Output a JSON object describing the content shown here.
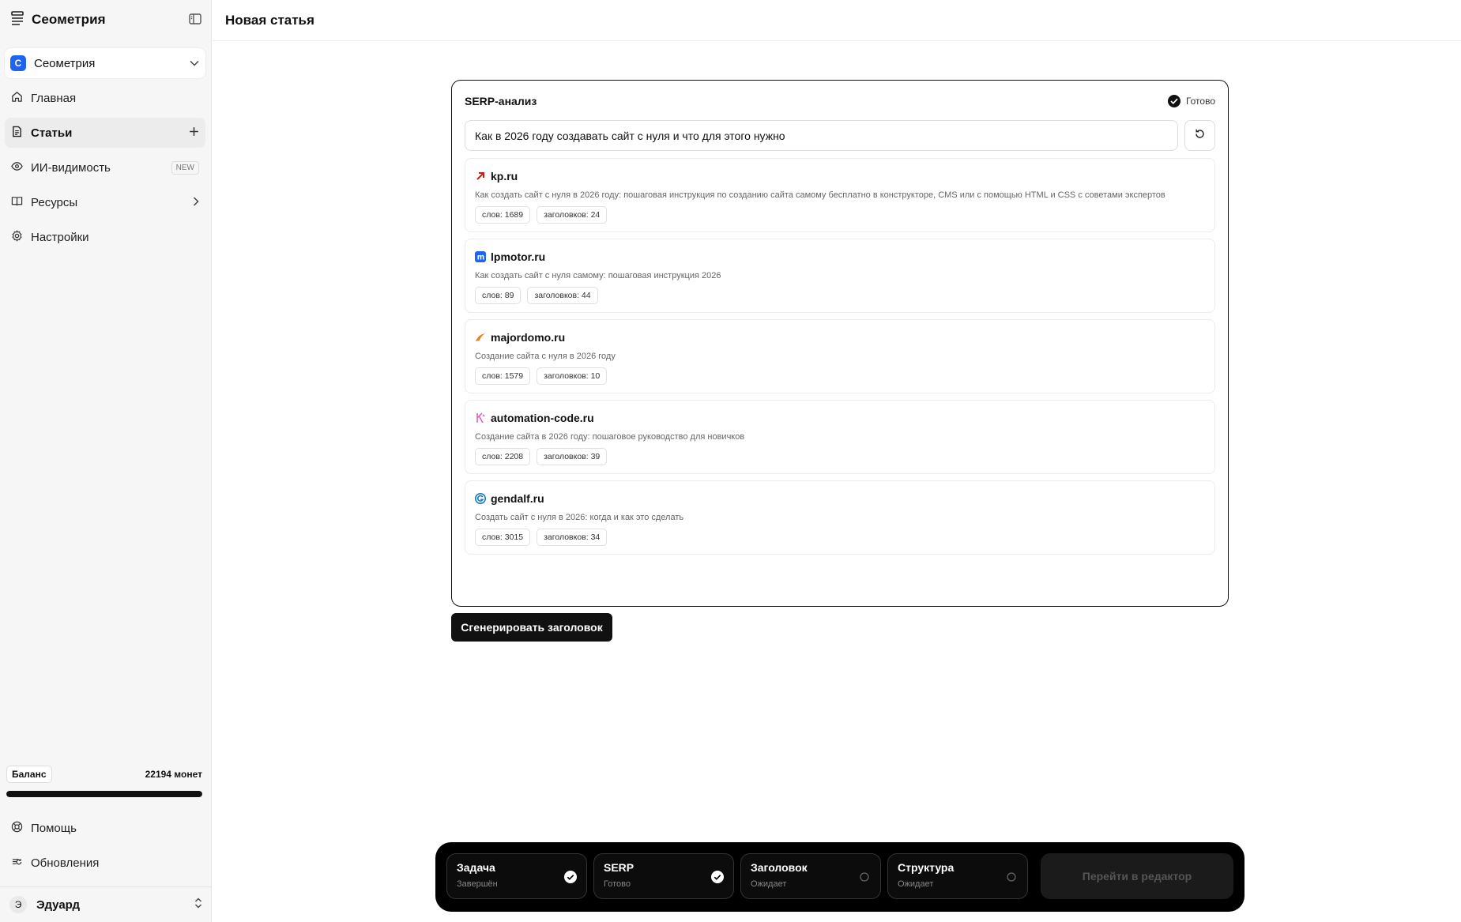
{
  "app": {
    "name": "Сеометрия"
  },
  "workspace": {
    "badge": "С",
    "name": "Сеометрия"
  },
  "sidebar": {
    "items": [
      {
        "label": "Главная",
        "icon": "home-icon"
      },
      {
        "label": "Статьи",
        "icon": "document-icon",
        "active": true
      },
      {
        "label": "ИИ-видимость",
        "icon": "eye-icon",
        "badge": "NEW"
      },
      {
        "label": "Ресурсы",
        "icon": "book-icon"
      },
      {
        "label": "Настройки",
        "icon": "gear-icon"
      }
    ],
    "bottom_items": [
      {
        "label": "Помощь",
        "icon": "lifebuoy-icon"
      },
      {
        "label": "Обновления",
        "icon": "refresh-list-icon"
      }
    ]
  },
  "balance": {
    "label": "Баланс",
    "value": "22194 монет",
    "fill_fraction": 1.0
  },
  "user": {
    "initial": "Э",
    "name": "Эдуард"
  },
  "header": {
    "title": "Новая статья"
  },
  "serp": {
    "title": "SERP-анализ",
    "status": "Готово",
    "query": "Как в 2026 году создавать сайт с нуля и что для этого нужно",
    "results": [
      {
        "domain": "kp.ru",
        "snippet": "Как создать сайт с нуля в 2026 году: пошаговая инструкция по созданию сайта самому бесплатно в конструкторе, CMS или с помощью HTML и CSS с советами экспертов",
        "words": "слов: 1689",
        "headings": "заголовков: 24"
      },
      {
        "domain": "lpmotor.ru",
        "snippet": "Как создать сайт с нуля самому: пошаговая инструкция 2026",
        "words": "слов: 89",
        "headings": "заголовков: 44"
      },
      {
        "domain": "majordomo.ru",
        "snippet": "Создание сайта с нуля в 2026 году",
        "words": "слов: 1579",
        "headings": "заголовков: 10"
      },
      {
        "domain": "automation-code.ru",
        "snippet": "Создание сайта в 2026 году: пошаговое руководство для новичков",
        "words": "слов: 2208",
        "headings": "заголовков: 39"
      },
      {
        "domain": "gendalf.ru",
        "snippet": "Создать сайт с нуля в 2026: когда и как это сделать",
        "words": "слов: 3015",
        "headings": "заголовков: 34"
      }
    ]
  },
  "actions": {
    "generate_title": "Сгенерировать заголовок"
  },
  "stepper": {
    "steps": [
      {
        "title": "Задача",
        "status": "Завершён",
        "done": true
      },
      {
        "title": "SERP",
        "status": "Готово",
        "done": true
      },
      {
        "title": "Заголовок",
        "status": "Ожидает",
        "done": false
      },
      {
        "title": "Структура",
        "status": "Ожидает",
        "done": false
      }
    ],
    "go_label": "Перейти в редактор"
  },
  "colors": {
    "accent": "#1f64f0",
    "dark": "#111111"
  }
}
